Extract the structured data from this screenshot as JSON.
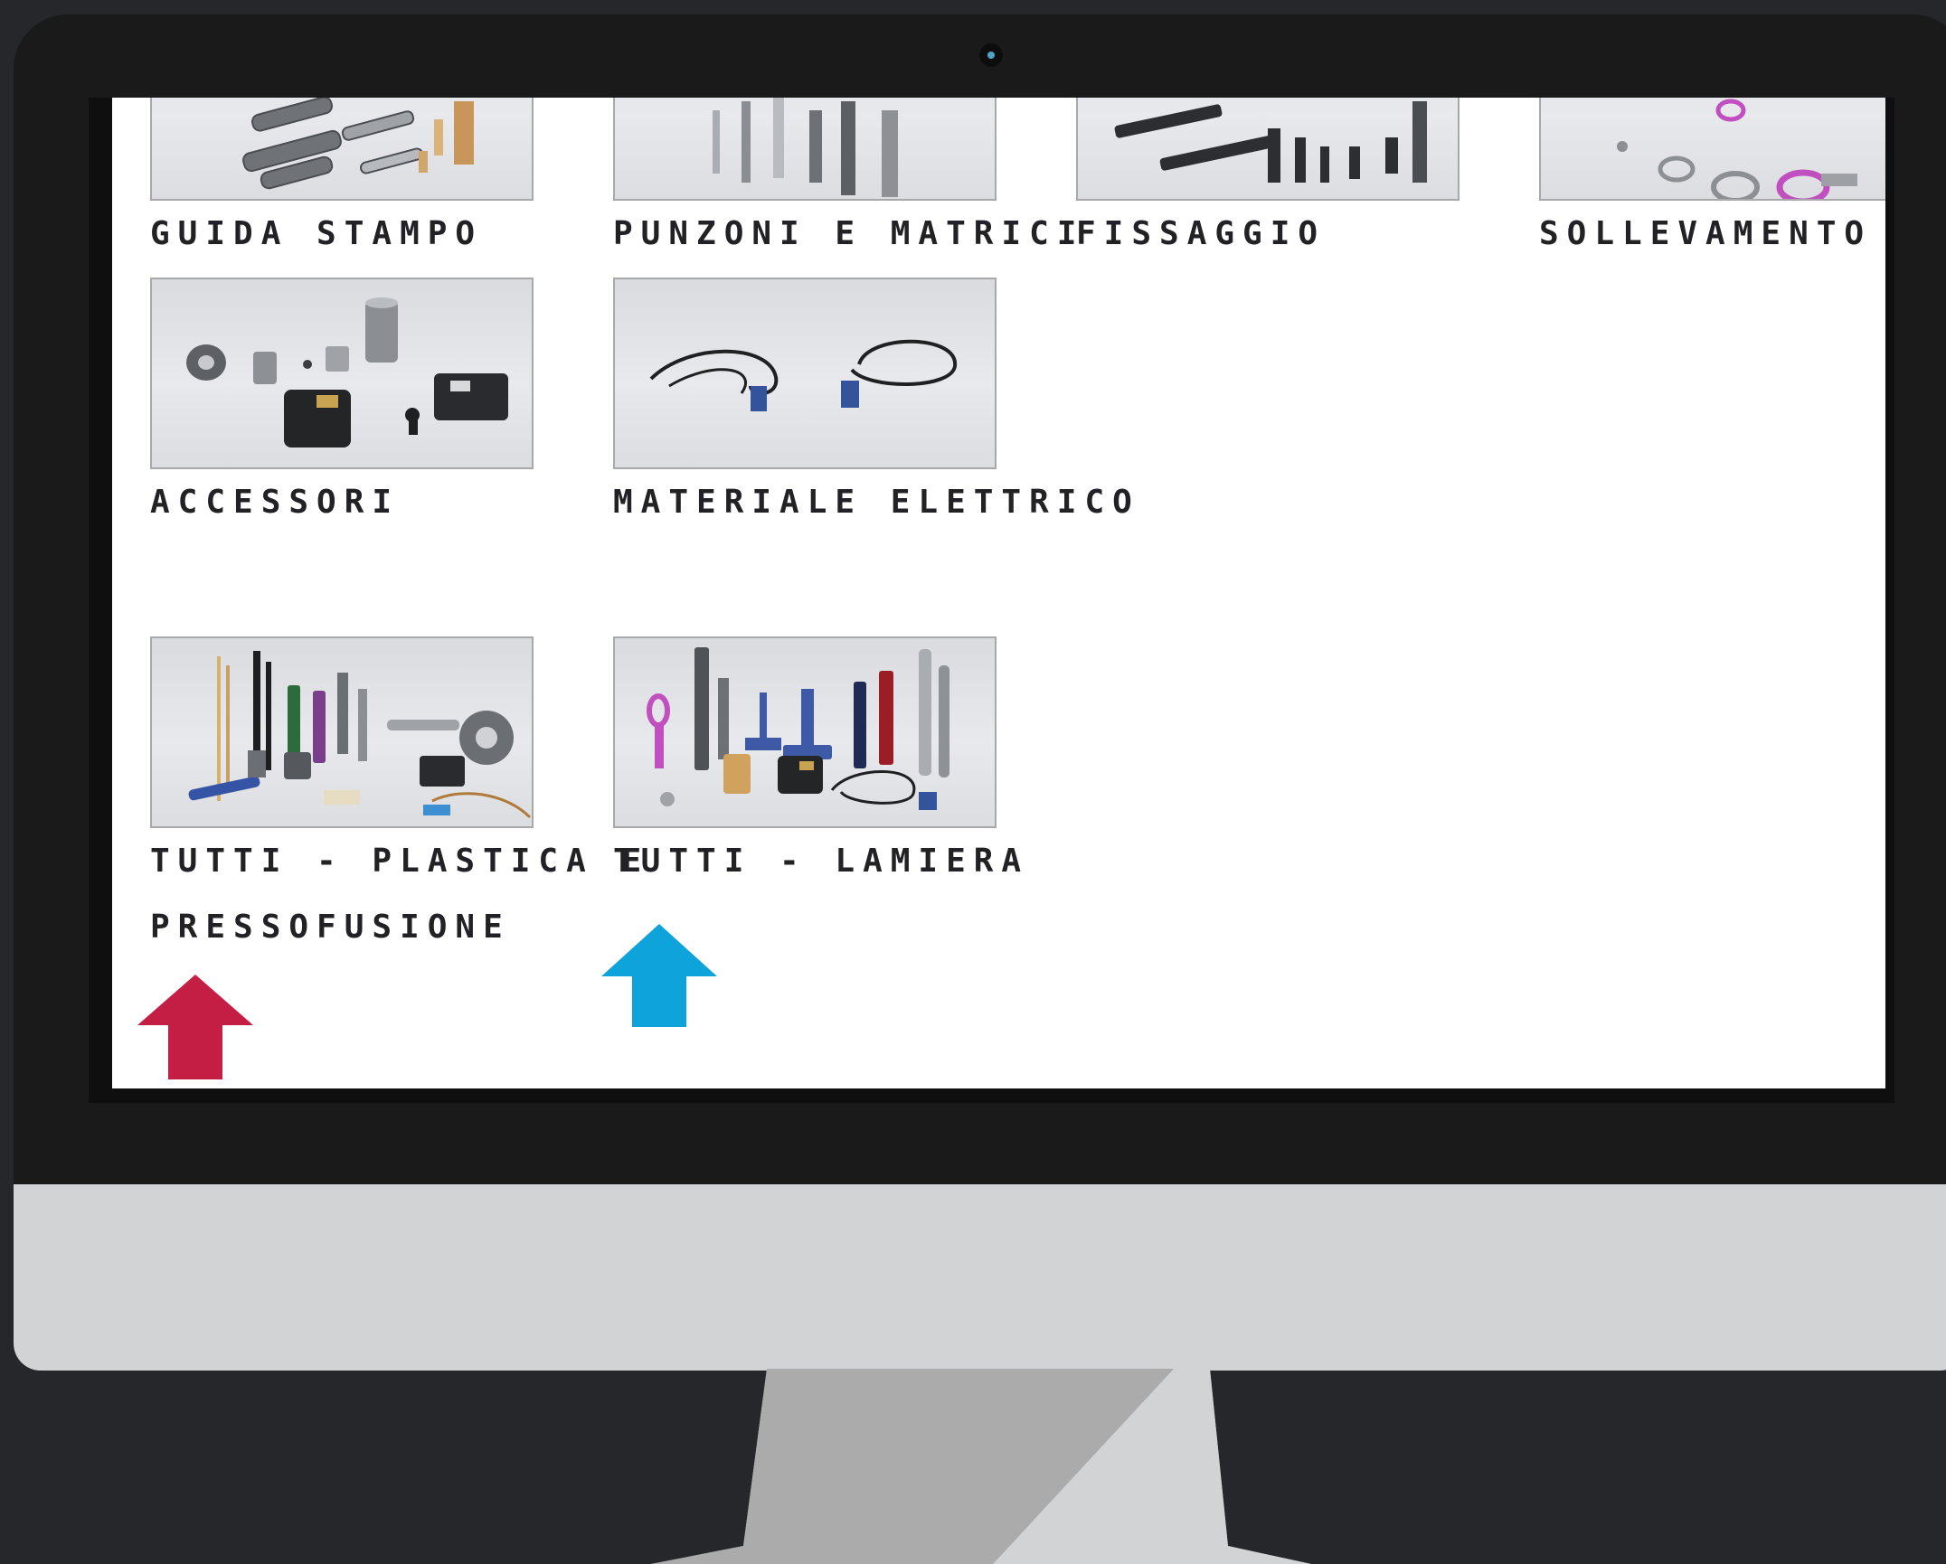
{
  "categories": [
    {
      "label": "GUIDA STAMPO"
    },
    {
      "label": "PUNZONI E MATRICI"
    },
    {
      "label": "FISSAGGIO"
    },
    {
      "label": "SOLLEVAMENTO"
    },
    {
      "label": "ACCESSORI"
    },
    {
      "label": "MATERIALE ELETTRICO"
    },
    {
      "label_line1": "TUTTI - PLASTICA E",
      "label_line2": "PRESSOFUSIONE"
    },
    {
      "label": "TUTTI - LAMIERA"
    }
  ],
  "arrows": {
    "left_color": "#c41e45",
    "right_color": "#0ea3da"
  },
  "colors": {
    "background": "#26272b",
    "bezel": "#1a1a1b",
    "chin": "#d2d3d5",
    "screen": "#ffffff",
    "label_text": "#222226"
  }
}
